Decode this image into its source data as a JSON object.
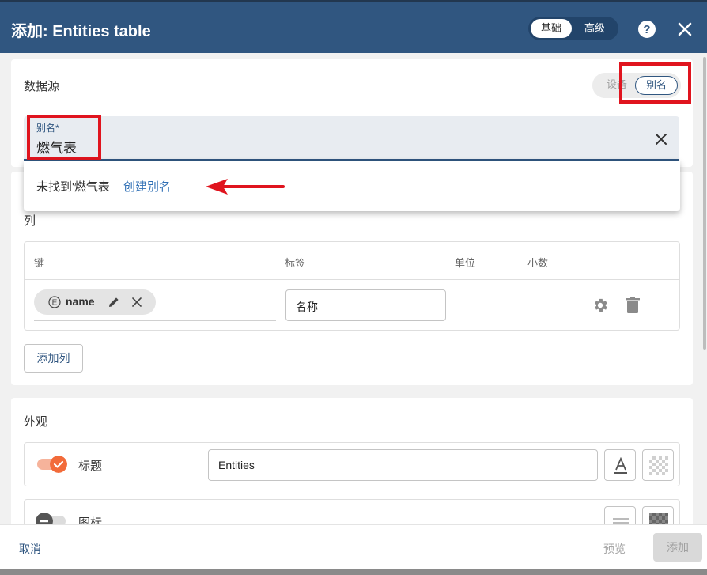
{
  "header": {
    "title": "添加: Entities table",
    "mode_basic": "基础",
    "mode_advanced": "高级",
    "help_icon": "help-circle-icon",
    "close_icon": "close-icon"
  },
  "datasource": {
    "section_title": "数据源",
    "type_options": [
      "设备",
      "别名"
    ],
    "type_device_visible": "设备",
    "type_selected": "别名",
    "alias_field": {
      "label": "别名*",
      "value": "燃气表"
    },
    "dropdown": {
      "not_found_text": "未找到'燃气表",
      "create_link": "创建别名"
    }
  },
  "columns": {
    "section_title": "列",
    "headers": [
      "键",
      "标签",
      "单位",
      "小数"
    ],
    "rows": [
      {
        "key_chip": "name",
        "key_icon": "entity-e-icon",
        "label": "名称"
      }
    ],
    "add_button": "添加列"
  },
  "appearance": {
    "section_title": "外观",
    "title_row": {
      "label": "标题",
      "enabled": true,
      "value": "Entities"
    },
    "icon_row": {
      "label": "图标",
      "enabled": false
    }
  },
  "footer": {
    "cancel": "取消",
    "preview": "预览",
    "add": "添加"
  },
  "colors": {
    "header_bg": "#305680",
    "accent": "#305680",
    "toggle_on": "#f26b3a",
    "annotation_red": "#e0141e",
    "link": "#2f6fb5"
  }
}
